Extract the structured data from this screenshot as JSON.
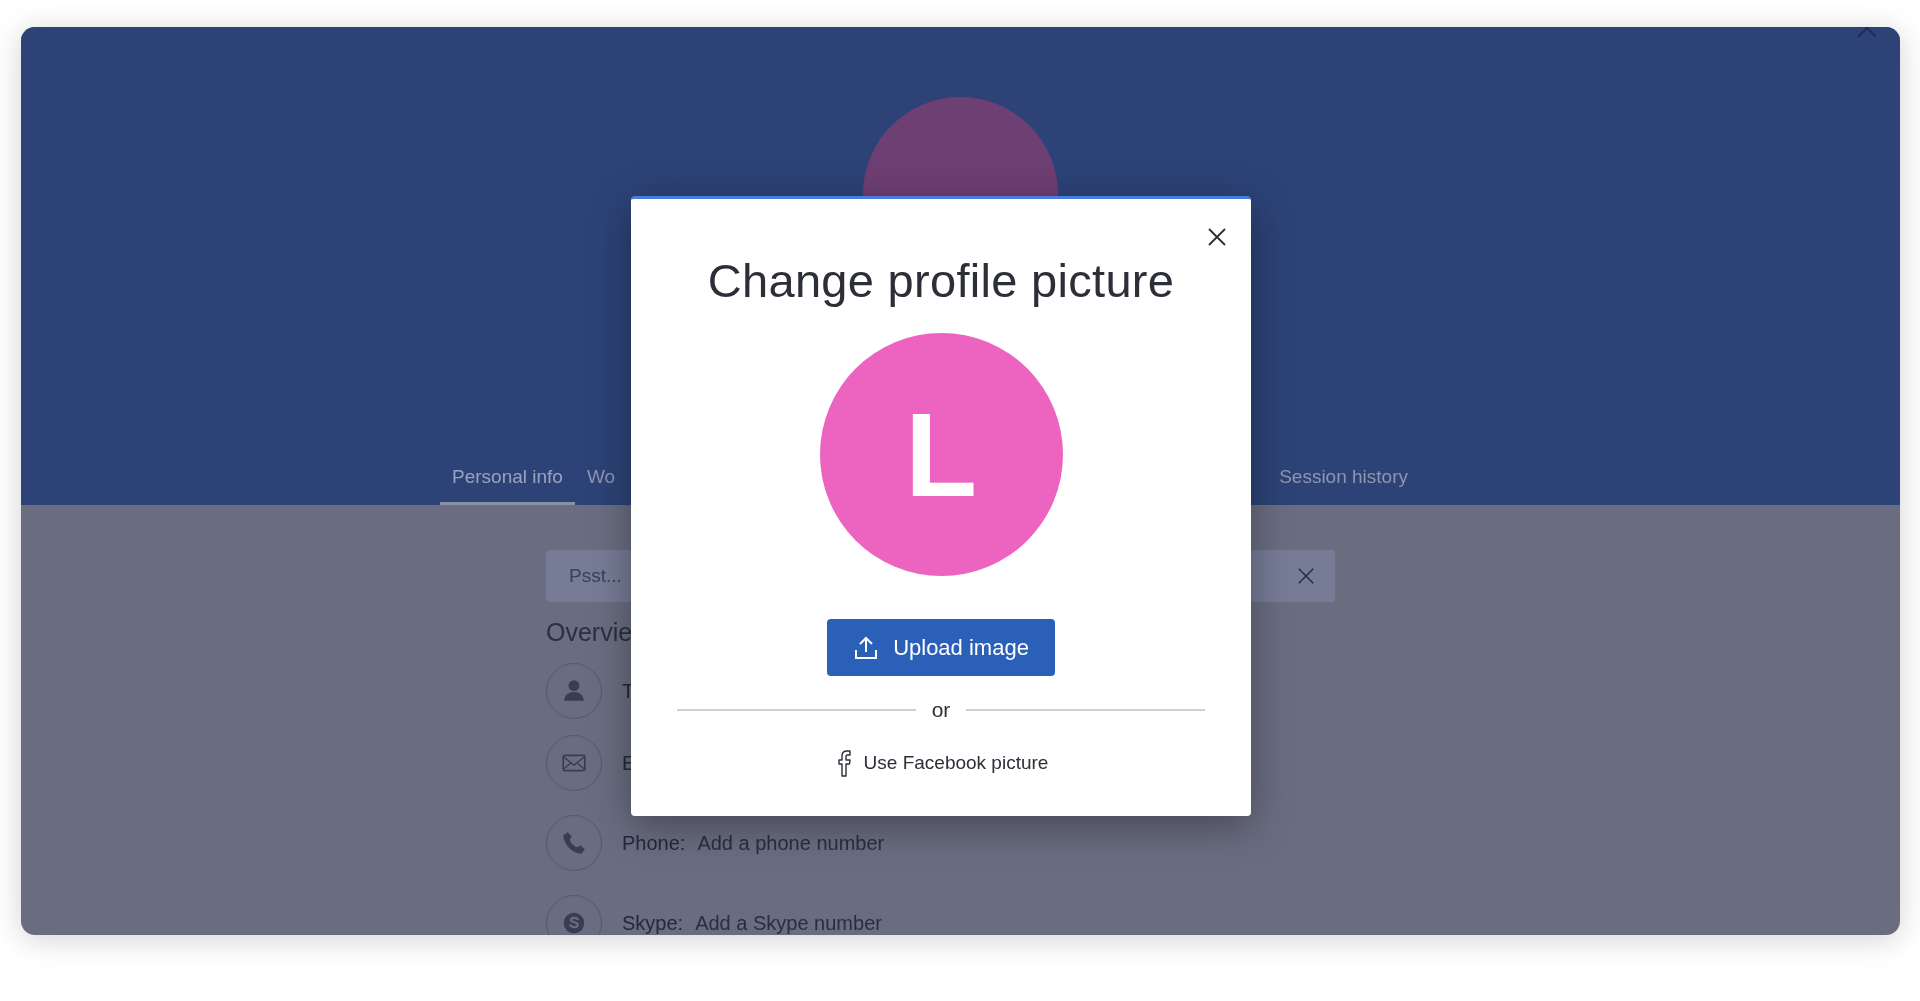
{
  "header": {
    "avatar": {
      "color": "#6e3f72"
    }
  },
  "tabs": [
    {
      "label": "Personal info",
      "selected": true
    },
    {
      "label": "Wo",
      "selected": false
    },
    {
      "label": "Session history",
      "selected": false
    }
  ],
  "banner": {
    "text": "Psst..."
  },
  "overview": {
    "title": "Overvie",
    "rows": [
      {
        "kind": "person",
        "label": "T",
        "value": ""
      },
      {
        "kind": "email",
        "label": "E",
        "value": ""
      },
      {
        "kind": "phone",
        "label": "Phone:",
        "value": "Add a phone number"
      },
      {
        "kind": "skype",
        "label": "Skype:",
        "value": "Add a Skype number"
      }
    ]
  },
  "dialog": {
    "title": "Change profile picture",
    "avatar": {
      "initial": "L",
      "color": "#ec64c0"
    },
    "upload_button": "Upload image",
    "separator": "or",
    "facebook_link": "Use Facebook picture"
  }
}
